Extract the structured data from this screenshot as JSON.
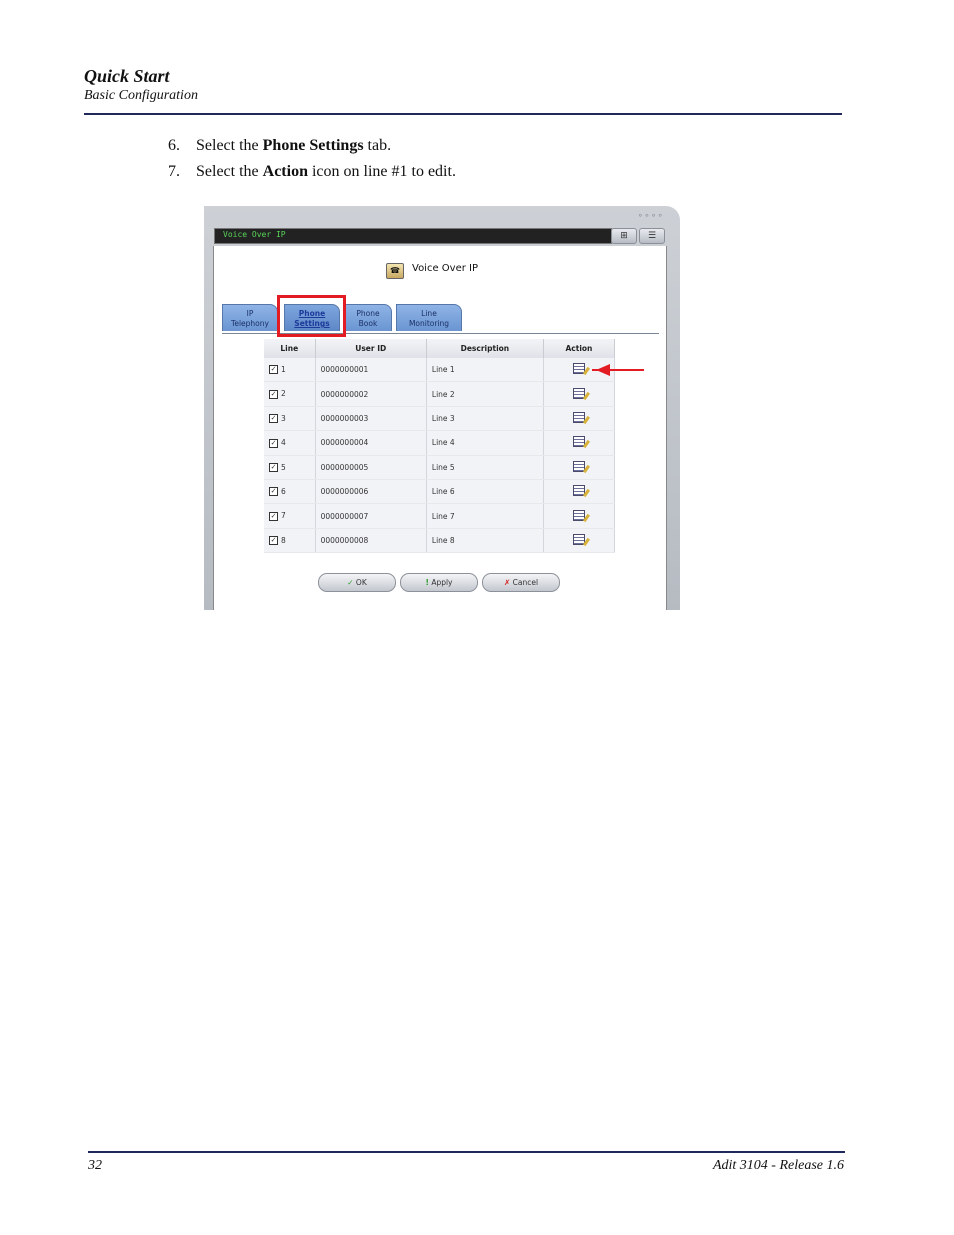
{
  "header": {
    "title": "Quick Start",
    "subtitle": "Basic Configuration"
  },
  "steps": [
    {
      "num": "6.",
      "pre": "Select the ",
      "bold": "Phone Settings",
      "post": " tab."
    },
    {
      "num": "7.",
      "pre": "Select the ",
      "bold": "Action",
      "post": " icon on line #1 to edit."
    }
  ],
  "screenshot": {
    "window_title": "Voice Over IP",
    "app_title": "Voice Over IP",
    "tabs": [
      {
        "line1": "IP",
        "line2": "Telephony"
      },
      {
        "line1": "Phone",
        "line2": "Settings"
      },
      {
        "line1": "Phone",
        "line2": "Book"
      },
      {
        "line1": "Line",
        "line2": "Monitoring"
      }
    ],
    "columns": [
      "Line",
      "User ID",
      "Description",
      "Action"
    ],
    "rows": [
      {
        "line": "1",
        "user_id": "0000000001",
        "desc": "Line 1"
      },
      {
        "line": "2",
        "user_id": "0000000002",
        "desc": "Line 2"
      },
      {
        "line": "3",
        "user_id": "0000000003",
        "desc": "Line 3"
      },
      {
        "line": "4",
        "user_id": "0000000004",
        "desc": "Line 4"
      },
      {
        "line": "5",
        "user_id": "0000000005",
        "desc": "Line 5"
      },
      {
        "line": "6",
        "user_id": "0000000006",
        "desc": "Line 6"
      },
      {
        "line": "7",
        "user_id": "0000000007",
        "desc": "Line 7"
      },
      {
        "line": "8",
        "user_id": "0000000008",
        "desc": "Line 8"
      }
    ],
    "buttons": {
      "ok": "OK",
      "apply": "Apply",
      "cancel": "Cancel"
    },
    "checkmark": "✓",
    "ok_glyph": "✓",
    "apply_glyph": "!",
    "cancel_glyph": "✗"
  },
  "footer": {
    "page": "32",
    "product": "Adit 3104  - Release 1.6"
  }
}
